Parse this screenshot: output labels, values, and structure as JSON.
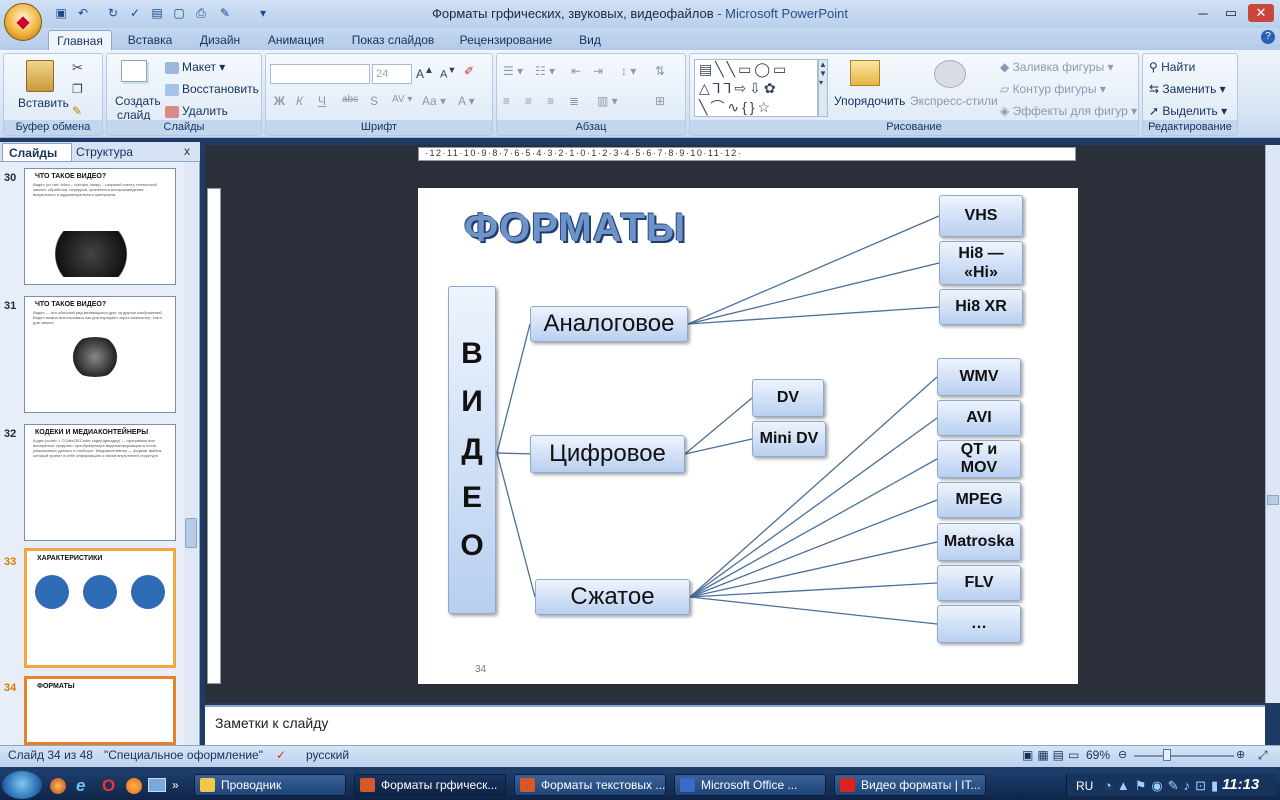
{
  "window": {
    "title": "Форматы грфических, звуковых, видеофайлов",
    "app": " - Microsoft PowerPoint"
  },
  "tabs": [
    "Главная",
    "Вставка",
    "Дизайн",
    "Анимация",
    "Показ слайдов",
    "Рецензирование",
    "Вид"
  ],
  "ribbon": {
    "clipboard": {
      "paste": "Вставить",
      "group": "Буфер обмена"
    },
    "slides": {
      "create": "Создать",
      "create2": "слайд",
      "layout": "Макет",
      "reset": "Восстановить",
      "delete": "Удалить",
      "group": "Слайды"
    },
    "font": {
      "size": "24",
      "bold": "Ж",
      "italic": "К",
      "underline": "Ч",
      "strike": "abc",
      "shadow": "S",
      "group": "Шрифт"
    },
    "paragraph": {
      "group": "Абзац"
    },
    "drawing": {
      "arrange": "Упорядочить",
      "quickstyles": "Экспресс-стили",
      "fill": "Заливка фигуры",
      "outline": "Контур фигуры",
      "effects": "Эффекты для фигур",
      "group": "Рисование"
    },
    "editing": {
      "find": "Найти",
      "replace": "Заменить",
      "select": "Выделить",
      "group": "Редактирование"
    }
  },
  "pane": {
    "tab_slides": "Слайды",
    "tab_outline": "Структура",
    "close": "x"
  },
  "thumbnails": [
    {
      "num": "30",
      "title": "ЧТО ТАКОЕ ВИДЕО?",
      "text": "Видео (от лат. video – смотрю, вижу) – широкий спектр технологий записи, обработки, передачи, хранения и воспроизведения визуального и аудиовизуального материала."
    },
    {
      "num": "31",
      "title": "ЧТО ТАКОЕ ВИДЕО?",
      "text": "Видео — это обычный ряд меняющихся друг за другом изображений. Видео можно использовать как для передачи через компьютер, так и для записи."
    },
    {
      "num": "32",
      "title": "КОДЕКИ И МЕДИАКОНТЕЙНЕРЫ",
      "text": "Кодек (codec = COder/DECoder кодер/декодер) — программа или аппаратное средство, преобразующее видеоинформацию в поток упакованных данных и наоборот. Медиаконтейнер — формат файла, который хранит в себе информацию о своей внутренней структуре."
    },
    {
      "num": "33",
      "title": "ХАРАКТЕРИСТИКИ",
      "text": ""
    },
    {
      "num": "34",
      "title": "ФОРМАТЫ",
      "text": ""
    }
  ],
  "ruler_text": "·12·11·10·9·8·7·6·5·4·3·2·1·0·1·2·3·4·5·6·7·8·9·10·11·12·",
  "slide": {
    "title": "ФОРМАТЫ",
    "root": "В И Д Е О",
    "number": "34",
    "categories": [
      "Аналоговое",
      "Цифровое",
      "Сжатое"
    ],
    "analog": [
      "VHS",
      "Hi8 — «Hi»",
      "Hi8 XR"
    ],
    "digital": [
      "DV",
      "Mini DV"
    ],
    "compressed": [
      "WMV",
      "AVI",
      "QT и MOV",
      "MPEG",
      "Matroska",
      "FLV",
      "…"
    ]
  },
  "notes_placeholder": "Заметки к слайду",
  "statusbar": {
    "slide": "Слайд 34 из 48",
    "theme": "\"Специальное оформление\"",
    "lang": "русский",
    "zoom": "69%"
  },
  "taskbar": {
    "items": [
      "Проводник",
      "Форматы грфическ...",
      "Форматы текстовых ...",
      "Microsoft Office ...",
      "Видео форматы | IT..."
    ],
    "lang": "RU",
    "clock": "11:13"
  }
}
